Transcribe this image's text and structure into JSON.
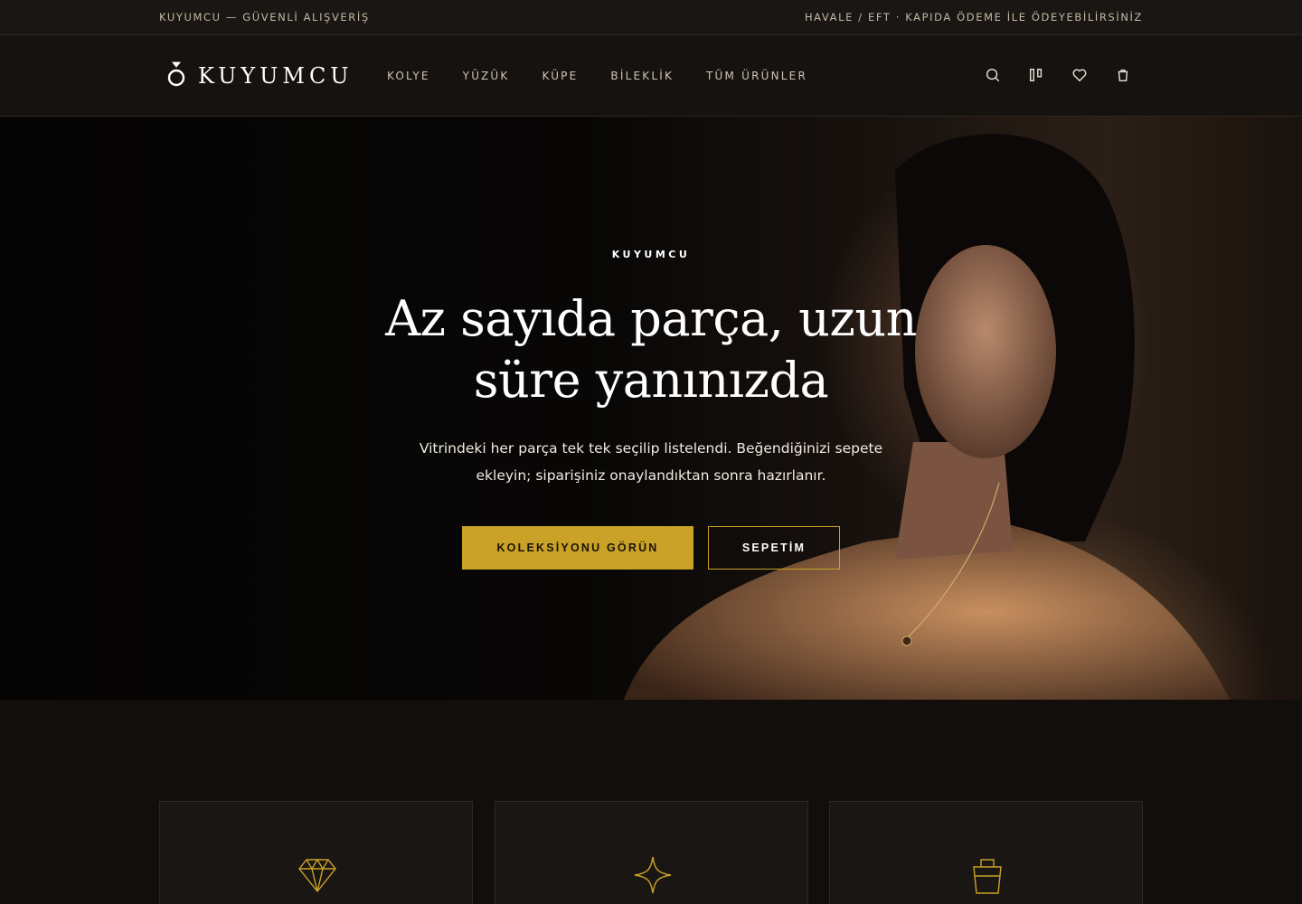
{
  "topbar": {
    "left_text": "KUYUMCU — GÜVENLİ ALIŞVERİŞ",
    "right_text": "HAVALE / EFT · KAPIDA ÖDEME İLE ÖDEYEBİLİRSİNİZ"
  },
  "header": {
    "logo_text": "KUYUMCU",
    "logo_icon": "ring-icon",
    "nav": [
      {
        "label": "KOLYE"
      },
      {
        "label": "YÜZÜK"
      },
      {
        "label": "KÜPE"
      },
      {
        "label": "BİLEKLİK"
      },
      {
        "label": "TÜM ÜRÜNLER"
      }
    ],
    "icons": [
      "search-icon",
      "compare-icon",
      "heart-icon",
      "shopping-bag-icon"
    ]
  },
  "hero": {
    "eyebrow": "KUYUMCU",
    "title": "Az sayıda parça, uzun süre yanınızda",
    "subtitle": "Vitrindeki her parça tek tek seçilip listelendi. Beğendiğinizi sepete ekleyin; siparişiniz onaylandıktan sonra hazırlanır.",
    "primary_button": "KOLEKSİYONU GÖRÜN",
    "secondary_button": "SEPETİM"
  },
  "features": {
    "cards": [
      {
        "icon": "diamond-icon"
      },
      {
        "icon": "sparkle-icon"
      },
      {
        "icon": "shopping-bag-icon"
      }
    ]
  },
  "colors": {
    "accent_gold": "#c9a227",
    "background": "#110e0b",
    "topbar_bg": "#1a1613"
  }
}
